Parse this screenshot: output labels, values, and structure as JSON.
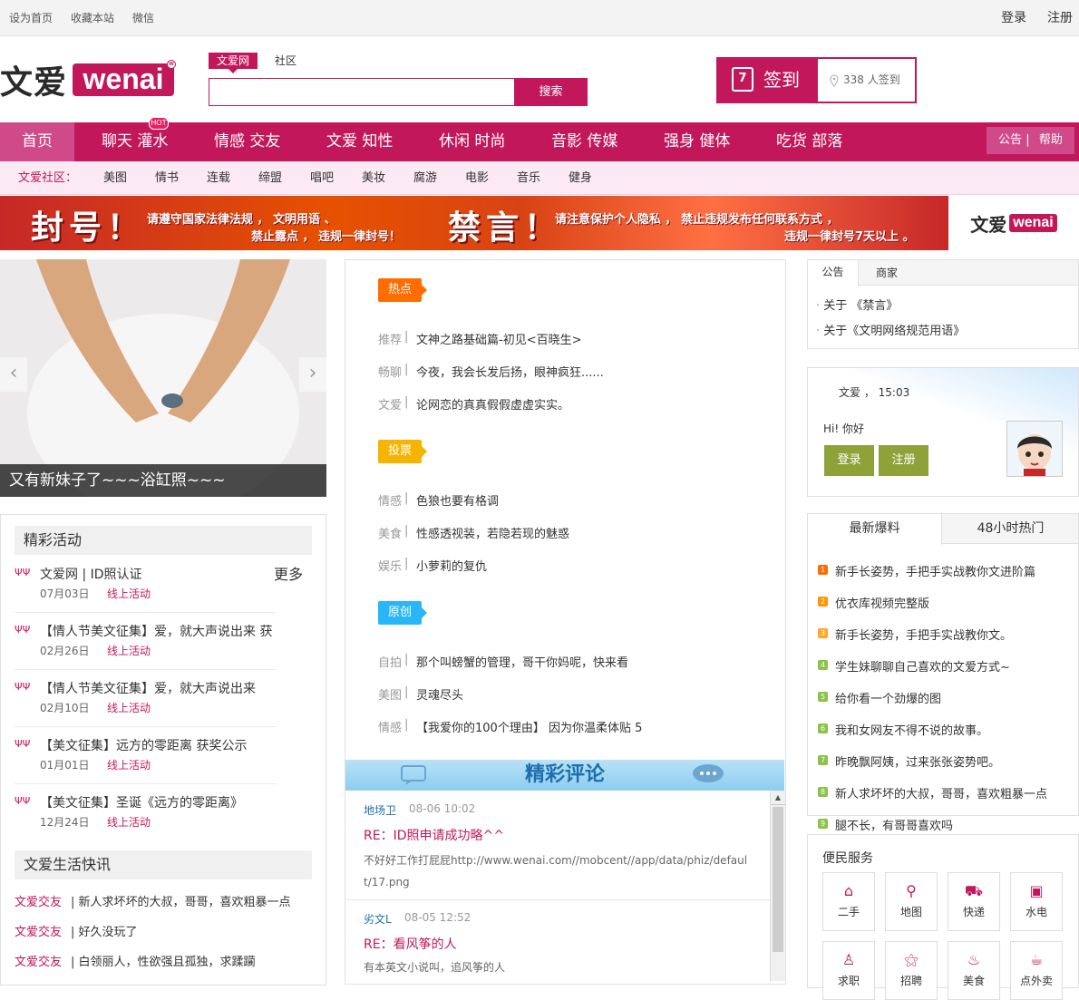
{
  "topbar": {
    "left_links": [
      "设为首页",
      "收藏本站",
      "微信"
    ],
    "login": "登录",
    "register": "注册"
  },
  "logo": {
    "cn": "文爱",
    "en": "wenai",
    "mark": "w"
  },
  "search": {
    "tabs": [
      "文爱网",
      "社区"
    ],
    "placeholder": "",
    "button": "搜索"
  },
  "signin": {
    "calendar_day": "7",
    "label": "签到",
    "count_text": "338 人签到"
  },
  "nav": {
    "items": [
      "首页",
      "聊天 灌水",
      "情感 交友",
      "文爱 知性",
      "休闲 时尚",
      "音影 传媒",
      "强身 健体",
      "吃货 部落"
    ],
    "hot_badge": "HOT",
    "announce": "公告",
    "help": "帮助"
  },
  "subnav": {
    "label": "文爱社区：",
    "items": [
      "美图",
      "情书",
      "连载",
      "缔盟",
      "唱吧",
      "美妆",
      "腐游",
      "电影",
      "音乐",
      "健身"
    ]
  },
  "banner": {
    "word1": "封号！",
    "text1a": "请遵守国家法律法规 ， 文明用语 、",
    "text1b": "禁止露点 ， 违规一律封号！",
    "word2": "禁言！",
    "text2a": "请注意保护个人隐私 ， 禁止违规发布任何联系方式 ，",
    "text2b": "违规一律封号7天以上 。"
  },
  "slide": {
    "caption": "又有新妹子了~~~浴缸照~~~"
  },
  "activities": {
    "title": "精彩活动",
    "more": "更多",
    "items": [
      {
        "title": "文爱网 | ID照认证",
        "date": "07月03日",
        "type": "线上活动"
      },
      {
        "title": "【情人节美文征集】爱，就大声说出来 获",
        "date": "02月26日",
        "type": "线上活动"
      },
      {
        "title": "【情人节美文征集】爱，就大声说出来",
        "date": "02月10日",
        "type": "线上活动"
      },
      {
        "title": "【美文征集】远方的零距离 获奖公示",
        "date": "01月01日",
        "type": "线上活动"
      },
      {
        "title": "【美文征集】圣诞《远方的零距离》",
        "date": "12月24日",
        "type": "线上活动"
      }
    ]
  },
  "news": {
    "title": "文爱生活快讯",
    "items": [
      {
        "cat": "文爱交友",
        "text": "新人求坏坏的大叔，哥哥，喜欢粗暴一点"
      },
      {
        "cat": "文爱交友",
        "text": "好久没玩了"
      },
      {
        "cat": "文爱交友",
        "text": "白领丽人，性欲强且孤独，求蹂躏"
      }
    ]
  },
  "center": {
    "sections": [
      {
        "tag": "热点",
        "color": "#ff6d00",
        "rows": [
          {
            "cat": "推荐",
            "title": "文神之路基础篇-初见<百晓生>"
          },
          {
            "cat": "畅聊",
            "title": "今夜，我会长发后扬，眼神疯狂......"
          },
          {
            "cat": "文爱",
            "title": "论网恋的真真假假虚虚实实。"
          }
        ]
      },
      {
        "tag": "投票",
        "color": "#f4b400",
        "rows": [
          {
            "cat": "情感",
            "title": "色狼也要有格调"
          },
          {
            "cat": "美食",
            "title": "性感透视装，若隐若现的魅惑"
          },
          {
            "cat": "娱乐",
            "title": "小萝莉的复仇"
          }
        ]
      },
      {
        "tag": "原创",
        "color": "#29b6f6",
        "rows": [
          {
            "cat": "自拍",
            "title": "那个叫螃蟹的管理，哥干你妈呢，快来看"
          },
          {
            "cat": "美图",
            "title": "灵魂尽头"
          },
          {
            "cat": "情感",
            "title": "【我爱你的100个理由】 因为你温柔体贴 5"
          }
        ]
      }
    ],
    "comments_banner": "精彩评论",
    "comments": [
      {
        "user": "地场卫",
        "time": "08-06 10:02",
        "title": "RE：ID照申请成功略^^",
        "body": "不好好工作打屁屁http://www.wenai.com//mobcent//app/data/phiz/default/17.png"
      },
      {
        "user": "劣文L",
        "time": "08-05 12:52",
        "title": "RE：看风筝的人",
        "body": "有本英文小说叫，追风筝的人"
      }
    ]
  },
  "notice": {
    "tabs": [
      "公告",
      "商家"
    ],
    "items": [
      "关于 《禁言》",
      "关于《文明网络规范用语》"
    ]
  },
  "user": {
    "site": "文爱",
    "time": "15:03",
    "greeting": "Hi! 你好",
    "login": "登录",
    "register": "注册"
  },
  "hot": {
    "tabs": [
      "最新爆料",
      "48小时热门"
    ],
    "items": [
      {
        "n": "1",
        "text": "新手长姿势，手把手实战教你文进阶篇"
      },
      {
        "n": "2",
        "text": "优衣库视频完整版"
      },
      {
        "n": "3",
        "text": "新手长姿势，手把手实战教你文。"
      },
      {
        "n": "4",
        "text": "学生妹聊聊自己喜欢的文爱方式~"
      },
      {
        "n": "5",
        "text": "给你看一个劲爆的图"
      },
      {
        "n": "6",
        "text": "我和女网友不得不说的故事。"
      },
      {
        "n": "7",
        "text": "昨晚飘阿姨，过来张张姿势吧。"
      },
      {
        "n": "8",
        "text": "新人求坏坏的大叔，哥哥，喜欢粗暴一点"
      },
      {
        "n": "9",
        "text": "腿不长，有哥哥喜欢吗"
      }
    ]
  },
  "services": {
    "title": "便民服务",
    "items": [
      "二手",
      "地图",
      "快递",
      "水电",
      "求职",
      "招聘",
      "美食",
      "点外卖"
    ]
  },
  "colors": {
    "brand": "#c2185b",
    "olive": "#8fa23a"
  }
}
